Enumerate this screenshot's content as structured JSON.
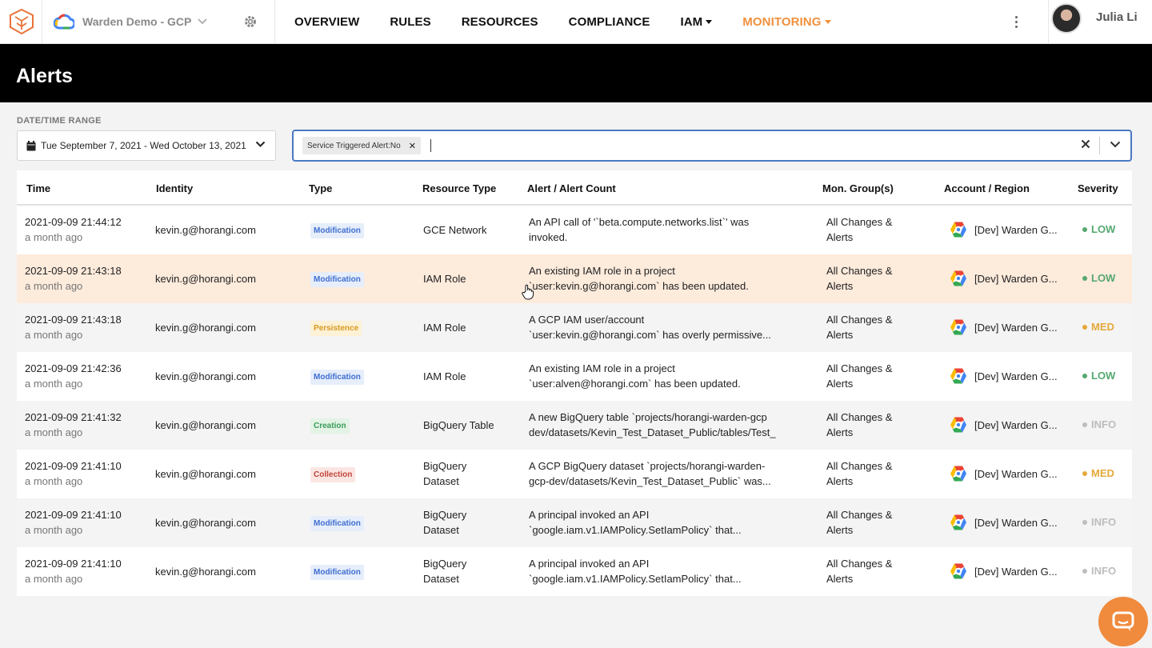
{
  "nav": {
    "project_name": "Warden Demo - GCP",
    "menu": [
      "OVERVIEW",
      "RULES",
      "RESOURCES",
      "COMPLIANCE",
      "IAM",
      "MONITORING"
    ],
    "active": "MONITORING",
    "user_name": "Julia Li"
  },
  "page": {
    "title": "Alerts"
  },
  "filters": {
    "date_label": "DATE/TIME RANGE",
    "date_value": "Tue September 7, 2021 - Wed October 13, 2021",
    "chip": "Service Triggered Alert:No"
  },
  "table": {
    "columns": [
      "Time",
      "Identity",
      "Type",
      "Resource Type",
      "Alert / Alert Count",
      "Mon. Group(s)",
      "Account / Region",
      "Severity"
    ],
    "rows": [
      {
        "time": "2021-09-09 21:44:12",
        "ago": "a month ago",
        "identity": "kevin.g@horangi.com",
        "type": "Modification",
        "resource": [
          "GCE Network"
        ],
        "alert": [
          "An API call of '`beta.compute.networks.list`' was",
          "invoked."
        ],
        "group": [
          "All Changes &",
          "Alerts"
        ],
        "account": "[Dev] Warden G...",
        "severity": "LOW"
      },
      {
        "time": "2021-09-09 21:43:18",
        "ago": "a month ago",
        "identity": "kevin.g@horangi.com",
        "type": "Modification",
        "resource": [
          "IAM Role"
        ],
        "alert": [
          "An existing IAM role in a project",
          "`user:kevin.g@horangi.com` has been updated."
        ],
        "group": [
          "All Changes &",
          "Alerts"
        ],
        "account": "[Dev] Warden G...",
        "severity": "LOW"
      },
      {
        "time": "2021-09-09 21:43:18",
        "ago": "a month ago",
        "identity": "kevin.g@horangi.com",
        "type": "Persistence",
        "resource": [
          "IAM Role"
        ],
        "alert": [
          "A GCP IAM user/account",
          "`user:kevin.g@horangi.com` has overly permissive..."
        ],
        "group": [
          "All Changes &",
          "Alerts"
        ],
        "account": "[Dev] Warden G...",
        "severity": "MED"
      },
      {
        "time": "2021-09-09 21:42:36",
        "ago": "a month ago",
        "identity": "kevin.g@horangi.com",
        "type": "Modification",
        "resource": [
          "IAM Role"
        ],
        "alert": [
          "An existing IAM role in a project",
          "`user:alven@horangi.com` has been updated."
        ],
        "group": [
          "All Changes &",
          "Alerts"
        ],
        "account": "[Dev] Warden G...",
        "severity": "LOW"
      },
      {
        "time": "2021-09-09 21:41:32",
        "ago": "a month ago",
        "identity": "kevin.g@horangi.com",
        "type": "Creation",
        "resource": [
          "BigQuery Table"
        ],
        "alert": [
          "A new BigQuery table `projects/horangi-warden-gcp",
          "dev/datasets/Kevin_Test_Dataset_Public/tables/Test_"
        ],
        "group": [
          "All Changes &",
          "Alerts"
        ],
        "account": "[Dev] Warden G...",
        "severity": "INFO"
      },
      {
        "time": "2021-09-09 21:41:10",
        "ago": "a month ago",
        "identity": "kevin.g@horangi.com",
        "type": "Collection",
        "resource": [
          "BigQuery",
          "Dataset"
        ],
        "alert": [
          "A GCP BigQuery dataset `projects/horangi-warden-",
          "gcp-dev/datasets/Kevin_Test_Dataset_Public` was..."
        ],
        "group": [
          "All Changes &",
          "Alerts"
        ],
        "account": "[Dev] Warden G...",
        "severity": "MED"
      },
      {
        "time": "2021-09-09 21:41:10",
        "ago": "a month ago",
        "identity": "kevin.g@horangi.com",
        "type": "Modification",
        "resource": [
          "BigQuery",
          "Dataset"
        ],
        "alert": [
          "A principal invoked an API",
          "`google.iam.v1.IAMPolicy.SetIamPolicy` that..."
        ],
        "group": [
          "All Changes &",
          "Alerts"
        ],
        "account": "[Dev] Warden G...",
        "severity": "INFO"
      },
      {
        "time": "2021-09-09 21:41:10",
        "ago": "a month ago",
        "identity": "kevin.g@horangi.com",
        "type": "Modification",
        "resource": [
          "BigQuery",
          "Dataset"
        ],
        "alert": [
          "A principal invoked an API",
          "`google.iam.v1.IAMPolicy.SetIamPolicy` that..."
        ],
        "group": [
          "All Changes &",
          "Alerts"
        ],
        "account": "[Dev] Warden G...",
        "severity": "INFO"
      }
    ]
  },
  "colors": {
    "accent": "#f08a3c",
    "focus": "#4a78c4",
    "low": "#55a86f",
    "med": "#e4a93a",
    "info": "#bdbdbd"
  }
}
